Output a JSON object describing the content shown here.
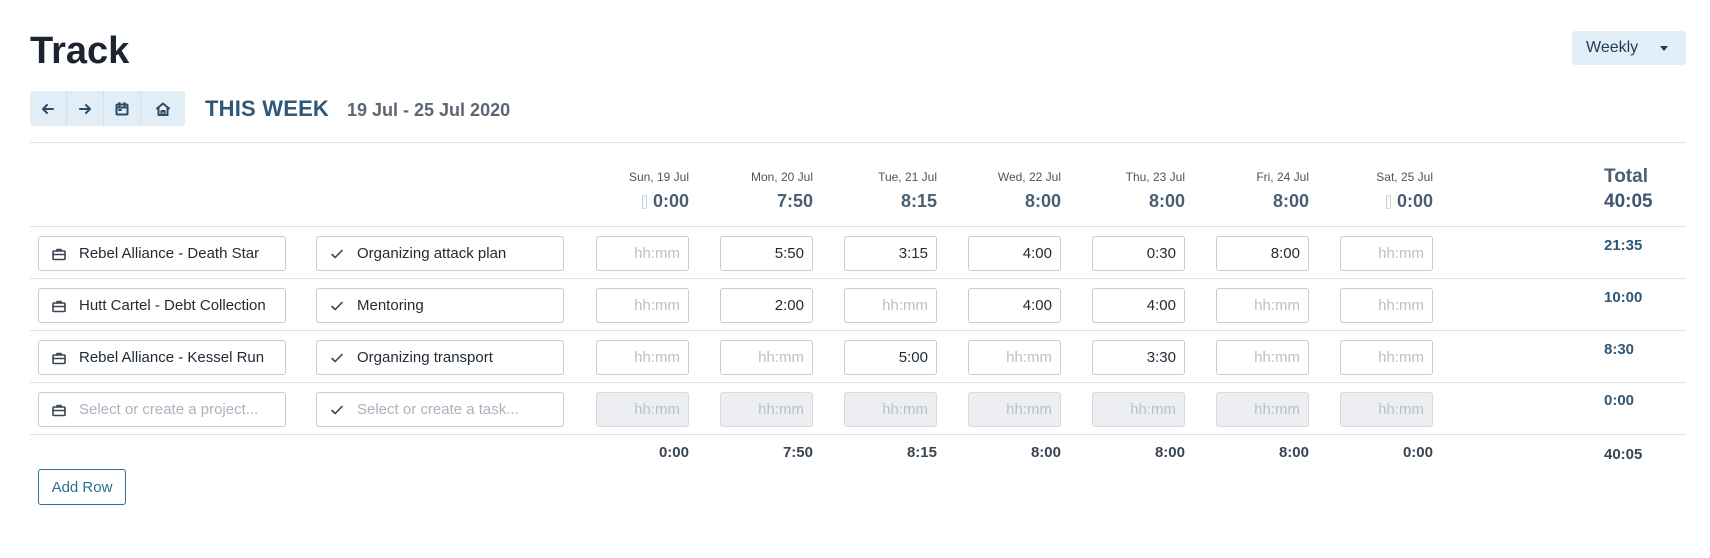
{
  "header": {
    "title": "Track",
    "view_select": "Weekly",
    "week_label": "THIS WEEK",
    "date_range": "19 Jul - 25 Jul 2020"
  },
  "nav": [
    {
      "name": "previous-week-button",
      "icon": "arrow-left-icon"
    },
    {
      "name": "next-week-button",
      "icon": "arrow-right-icon"
    },
    {
      "name": "calendar-button",
      "icon": "calendar-icon"
    },
    {
      "name": "home-button",
      "icon": "home-icon"
    }
  ],
  "days": [
    {
      "label": "Sun, 19 Jul",
      "total": "0:00",
      "zero": true
    },
    {
      "label": "Mon, 20 Jul",
      "total": "7:50",
      "zero": false
    },
    {
      "label": "Tue, 21 Jul",
      "total": "8:15",
      "zero": false
    },
    {
      "label": "Wed, 22 Jul",
      "total": "8:00",
      "zero": false
    },
    {
      "label": "Thu, 23 Jul",
      "total": "8:00",
      "zero": false
    },
    {
      "label": "Fri, 24 Jul",
      "total": "8:00",
      "zero": false
    },
    {
      "label": "Sat, 25 Jul",
      "total": "0:00",
      "zero": true
    }
  ],
  "total": {
    "label": "Total",
    "value": "40:05"
  },
  "time_placeholder": "hh:mm",
  "rows": [
    {
      "project": "Rebel Alliance - Death Star",
      "task": "Organizing attack plan",
      "times": [
        "",
        "5:50",
        "3:15",
        "4:00",
        "0:30",
        "8:00",
        ""
      ],
      "total": "21:35"
    },
    {
      "project": "Hutt Cartel - Debt Collection",
      "task": "Mentoring",
      "times": [
        "",
        "2:00",
        "",
        "4:00",
        "4:00",
        "",
        ""
      ],
      "total": "10:00"
    },
    {
      "project": "Rebel Alliance - Kessel Run",
      "task": "Organizing transport",
      "times": [
        "",
        "",
        "5:00",
        "",
        "3:30",
        "",
        ""
      ],
      "total": "8:30"
    }
  ],
  "new_row": {
    "project_placeholder": "Select or create a project...",
    "task_placeholder": "Select or create a task...",
    "total": "0:00"
  },
  "footer": {
    "totals": [
      "0:00",
      "7:50",
      "8:15",
      "8:00",
      "8:00",
      "8:00",
      "0:00"
    ],
    "grand_total": "40:05"
  },
  "add_row_label": "Add Row",
  "colors": {
    "accent": "#2f5777",
    "button_bg": "#e1eef8",
    "link": "#2f6f96"
  }
}
